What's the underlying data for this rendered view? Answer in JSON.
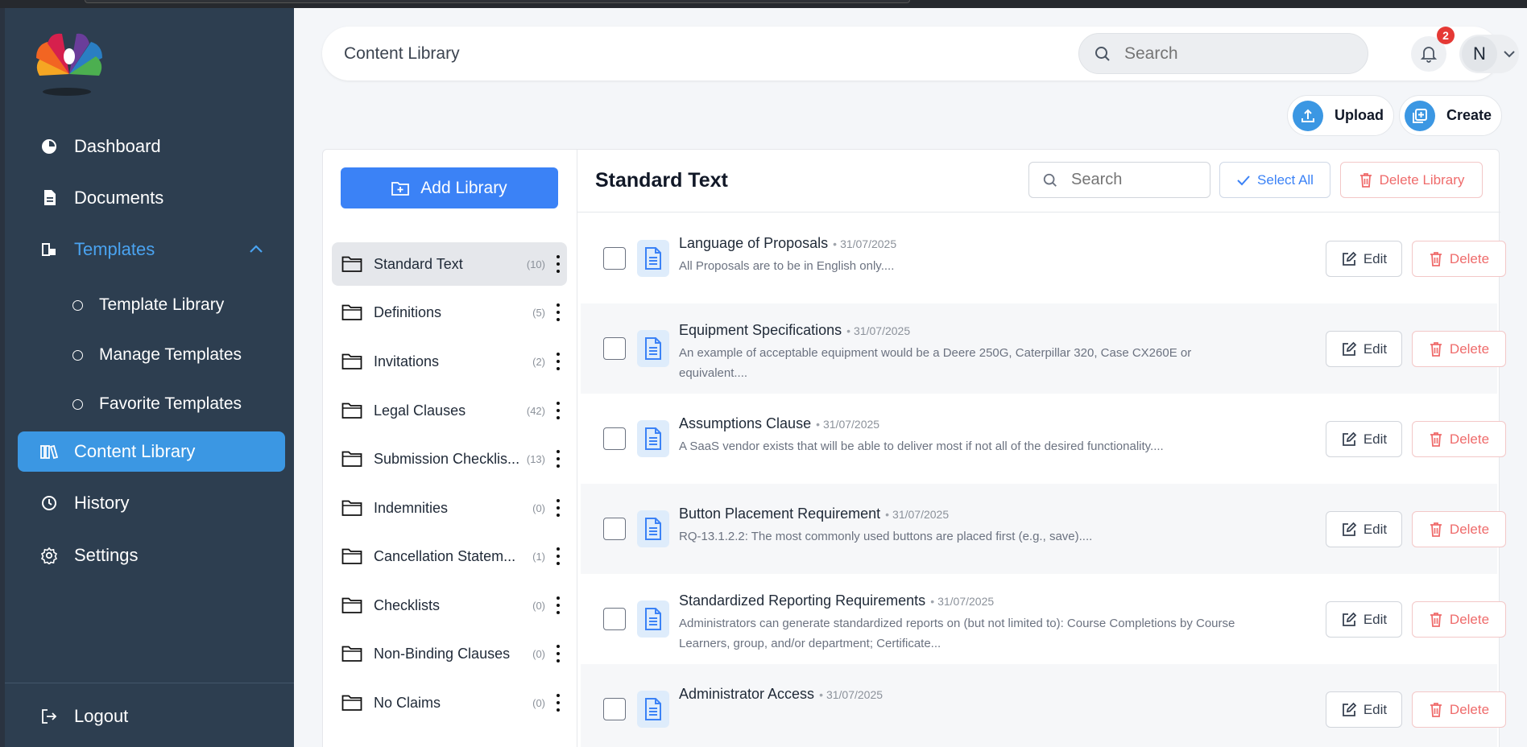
{
  "sidebar": {
    "items": [
      {
        "label": "Dashboard",
        "icon": "pie-chart-icon"
      },
      {
        "label": "Documents",
        "icon": "document-icon"
      },
      {
        "label": "Templates",
        "icon": "templates-icon"
      },
      {
        "label": "Content Library",
        "icon": "library-icon"
      },
      {
        "label": "History",
        "icon": "clock-icon"
      },
      {
        "label": "Settings",
        "icon": "gear-icon"
      }
    ],
    "sub_items": [
      {
        "label": "Template Library"
      },
      {
        "label": "Manage Templates"
      },
      {
        "label": "Favorite Templates"
      }
    ],
    "logout_label": "Logout"
  },
  "header": {
    "title": "Content Library",
    "search_placeholder": "Search",
    "notification_count": "2",
    "avatar_initial": "N"
  },
  "actions": {
    "upload_label": "Upload",
    "create_label": "Create"
  },
  "libraries": {
    "add_label": "Add Library",
    "items": [
      {
        "name": "Standard Text",
        "count": "(10)"
      },
      {
        "name": "Definitions",
        "count": "(5)"
      },
      {
        "name": "Invitations",
        "count": "(2)"
      },
      {
        "name": "Legal Clauses",
        "count": "(42)"
      },
      {
        "name": "Submission Checklis...",
        "count": "(13)"
      },
      {
        "name": "Indemnities",
        "count": "(0)"
      },
      {
        "name": "Cancellation Statem...",
        "count": "(1)"
      },
      {
        "name": "Checklists",
        "count": "(0)"
      },
      {
        "name": "Non-Binding Clauses",
        "count": "(0)"
      },
      {
        "name": "No Claims",
        "count": "(0)"
      }
    ]
  },
  "content": {
    "title": "Standard Text",
    "search_placeholder": "Search",
    "select_all_label": "Select All",
    "delete_library_label": "Delete Library",
    "edit_label": "Edit",
    "delete_label": "Delete",
    "rows": [
      {
        "title": "Language of Proposals",
        "date": "31/07/2025",
        "desc": "All Proposals are to be in English only...."
      },
      {
        "title": "Equipment Specifications",
        "date": "31/07/2025",
        "desc": "An example of acceptable equipment would be a Deere 250G, Caterpillar 320, Case CX260E or equivalent...."
      },
      {
        "title": "Assumptions Clause",
        "date": "31/07/2025",
        "desc": "A SaaS vendor exists that will be able to deliver most if not all of the desired functionality...."
      },
      {
        "title": "Button Placement Requirement",
        "date": "31/07/2025",
        "desc": "RQ-13.1.2.2: The most commonly used buttons are placed first (e.g., save)...."
      },
      {
        "title": "Standardized Reporting Requirements",
        "date": "31/07/2025",
        "desc": "Administrators can generate standardized reports on (but not limited to): Course Completions by Course Learners, group, and/or department; Certificate..."
      },
      {
        "title": "Administrator Access",
        "date": "31/07/2025",
        "desc": ""
      }
    ]
  },
  "colors": {
    "sidebar_bg": "#2d3e50",
    "accent": "#3b97e3",
    "primary_button": "#3b82f6",
    "danger": "#ef6b6b"
  }
}
